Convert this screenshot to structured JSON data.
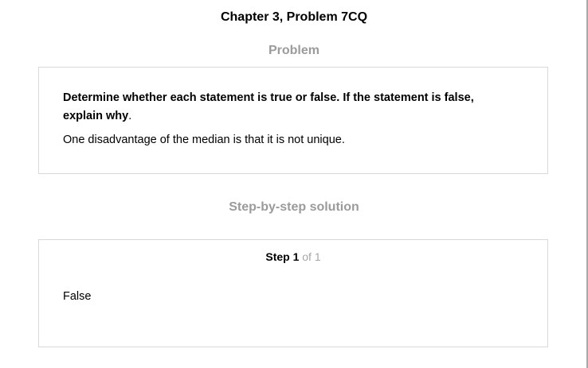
{
  "page": {
    "title": "Chapter 3, Problem 7CQ"
  },
  "problem": {
    "heading": "Problem",
    "instruction_bold": "Determine whether each statement is true or false. If the statement is false, explain why",
    "instruction_tail": ".",
    "statement": "One disadvantage of the median is that it is not unique."
  },
  "solution": {
    "heading": "Step-by-step solution",
    "step_label": "Step 1",
    "step_of": "of 1",
    "answer": "False"
  }
}
